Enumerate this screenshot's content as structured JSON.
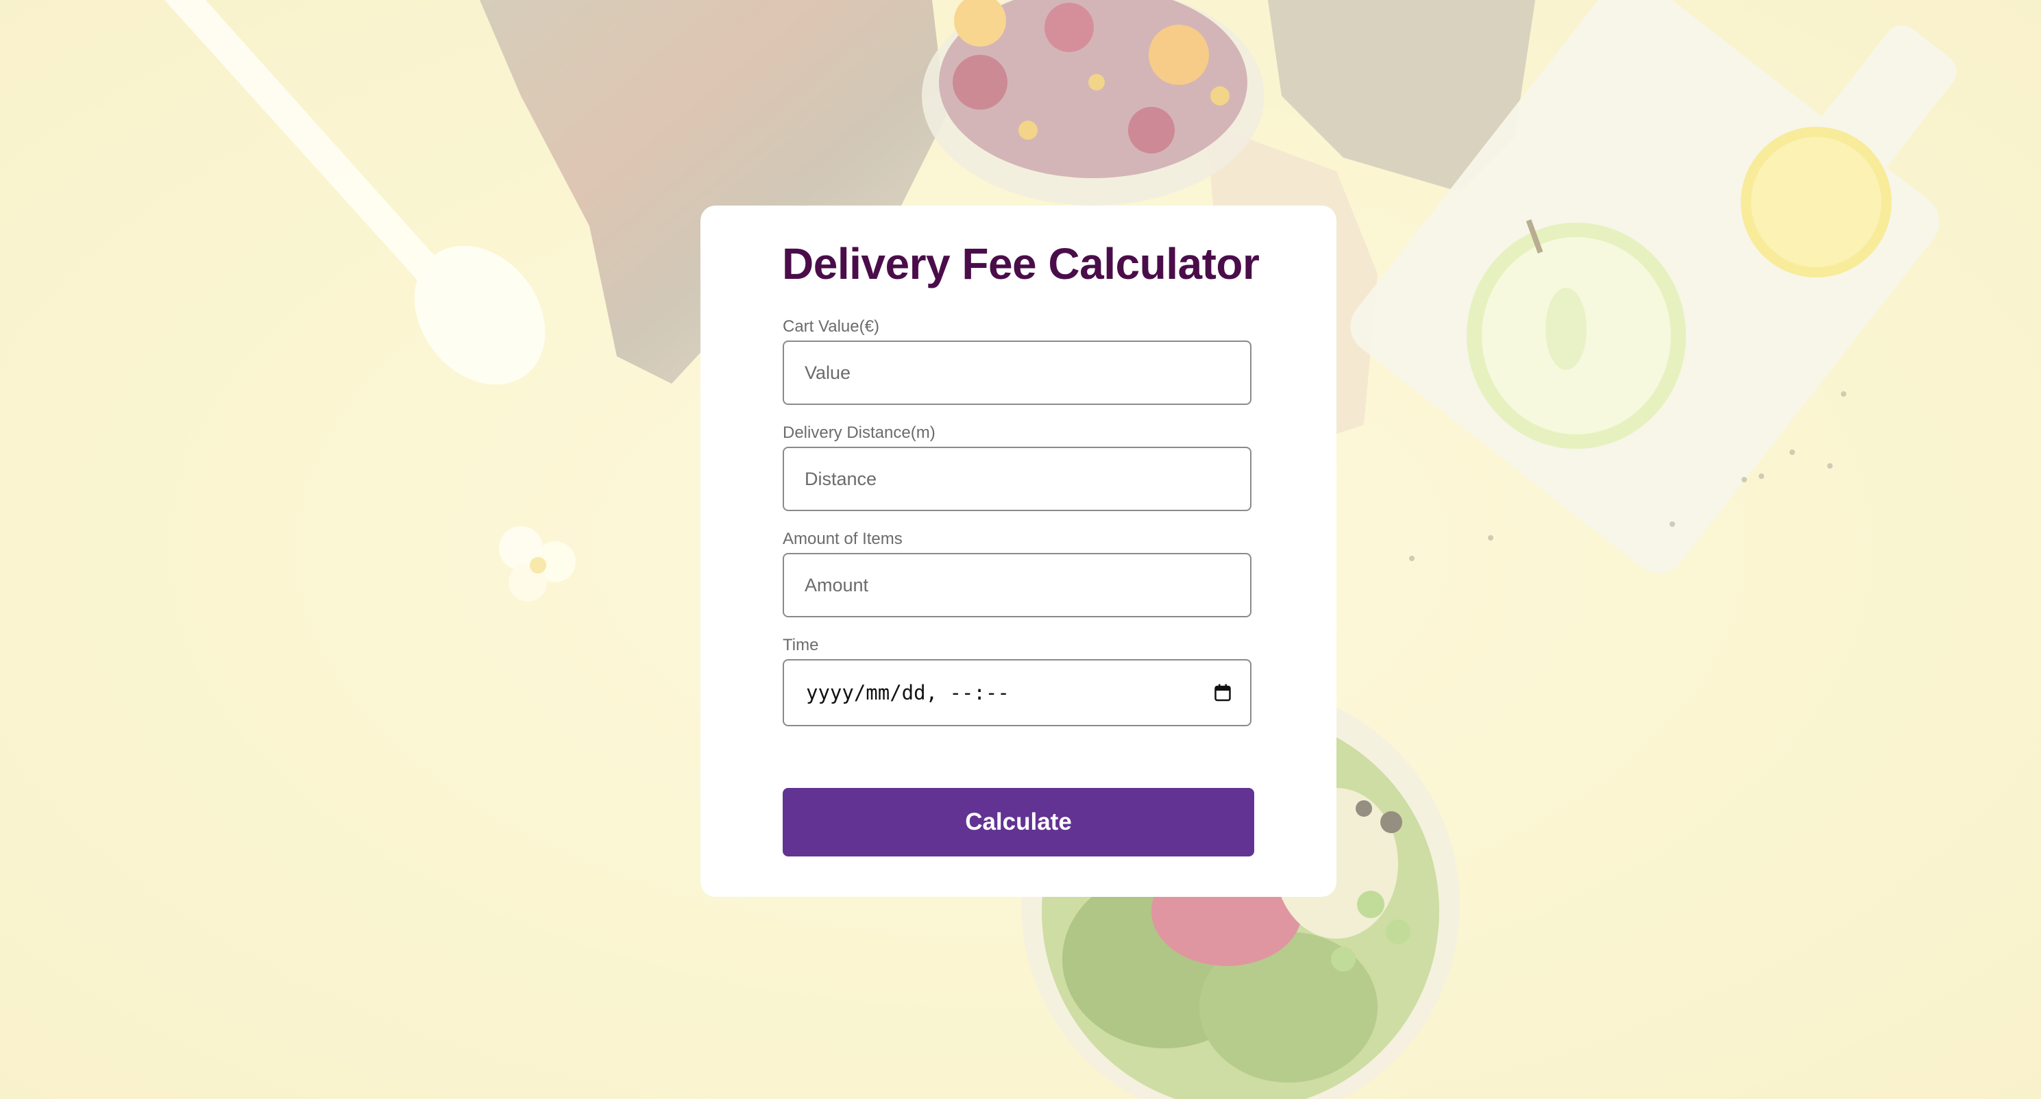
{
  "app": {
    "title": "Delivery Fee Calculator"
  },
  "form": {
    "cart_value": {
      "label": "Cart Value(€)",
      "placeholder": "Value"
    },
    "delivery_distance": {
      "label": "Delivery Distance(m)",
      "placeholder": "Distance"
    },
    "amount_of_items": {
      "label": "Amount of Items",
      "placeholder": "Amount"
    },
    "time": {
      "label": "Time",
      "placeholder": "yyyy/mm/dd, --:--",
      "icon": "calendar-icon"
    },
    "submit_label": "Calculate"
  },
  "colors": {
    "title": "#4a0d4a",
    "button": "#623393",
    "card": "#ffffff",
    "background": "#f7f0c8"
  },
  "background_image": {
    "icons": [
      "spoon-icon",
      "acai-bowl-icon",
      "sweater-icon",
      "cutting-board-icon",
      "apple-icon",
      "lemon-icon",
      "flower-icon",
      "salad-bowl-icon"
    ]
  }
}
